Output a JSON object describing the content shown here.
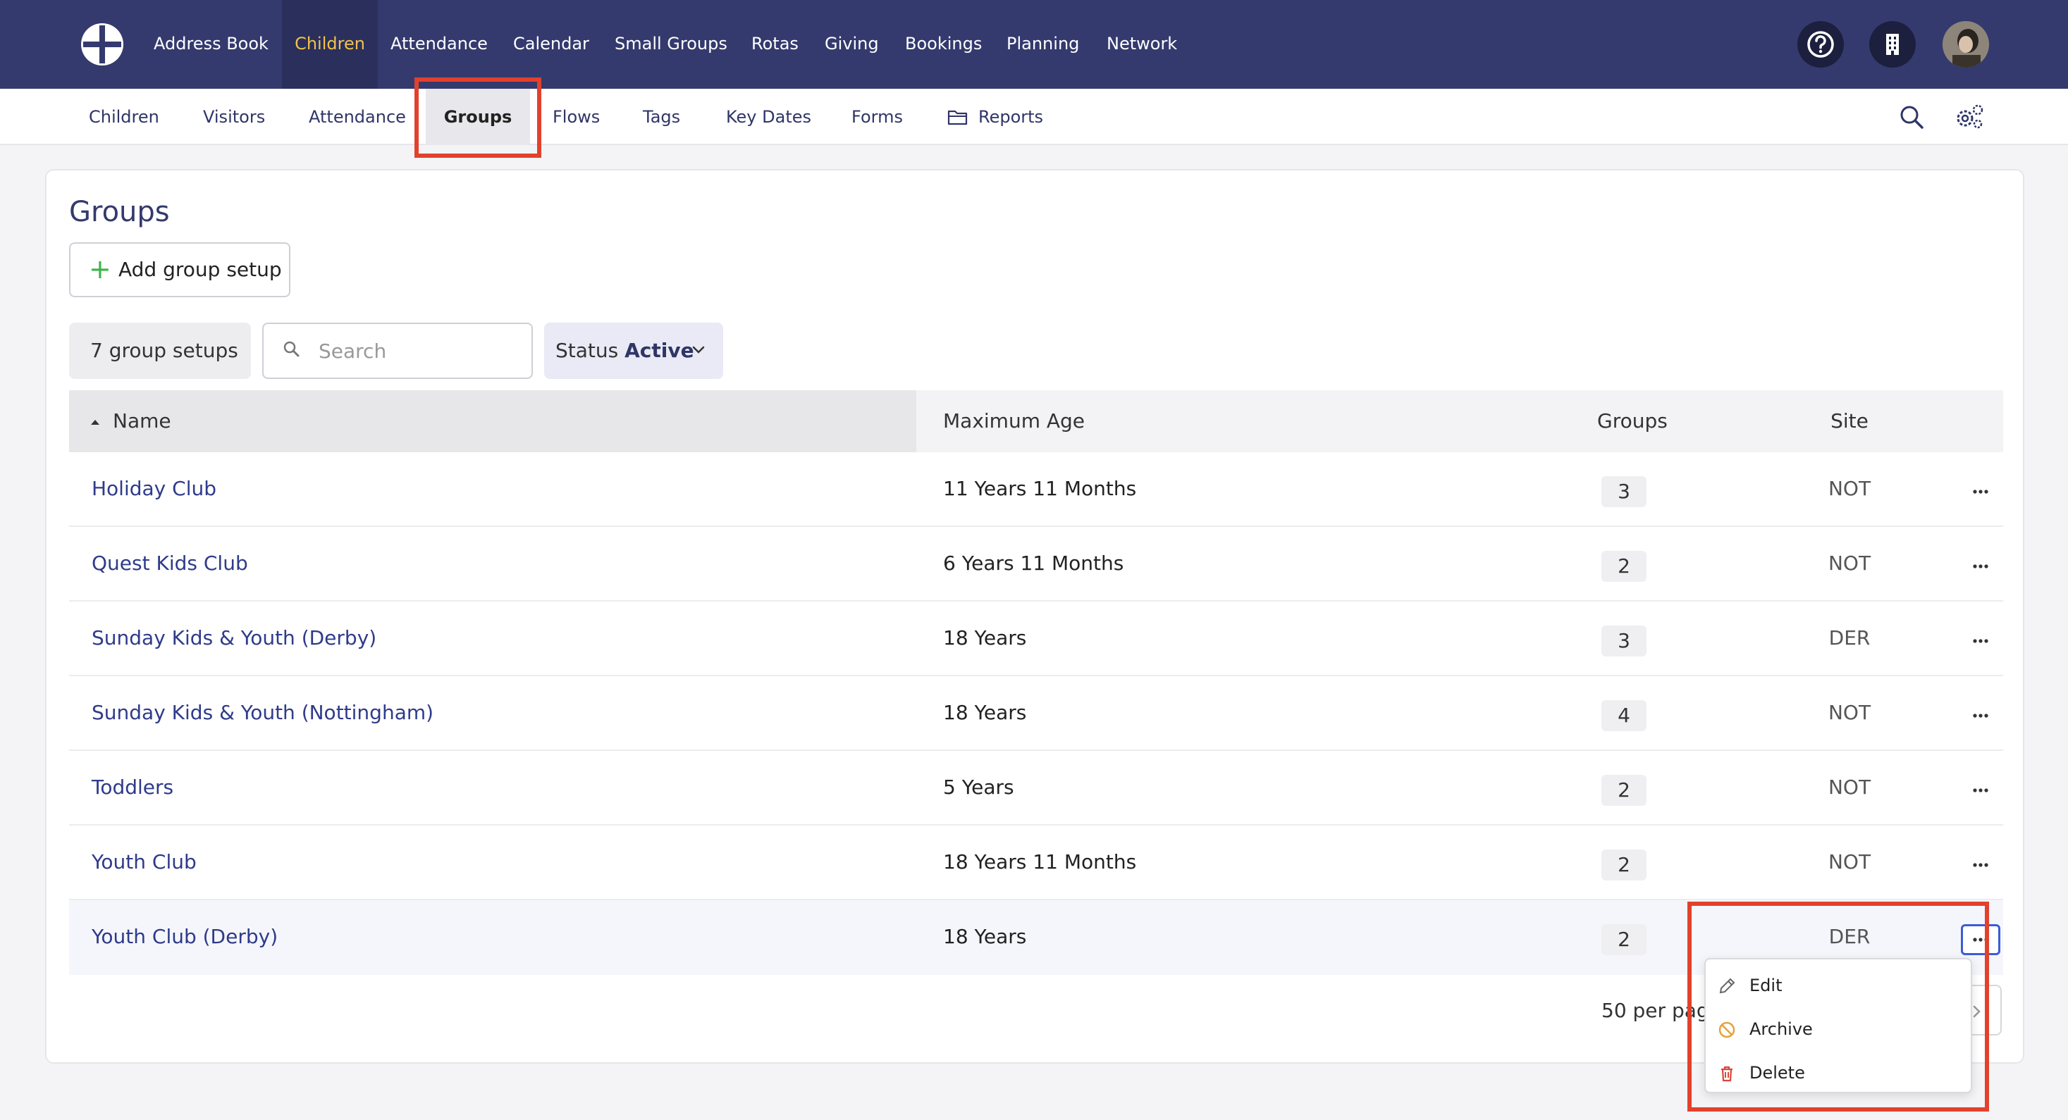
{
  "topnav": {
    "items": [
      "Address Book",
      "Children",
      "Attendance",
      "Calendar",
      "Small Groups",
      "Rotas",
      "Giving",
      "Bookings",
      "Planning",
      "Network"
    ],
    "active": "Children",
    "icons": [
      "help-icon",
      "building-icon",
      "avatar"
    ]
  },
  "subnav": {
    "items": [
      "Children",
      "Visitors",
      "Attendance",
      "Groups",
      "Flows",
      "Tags",
      "Key Dates",
      "Forms",
      "Reports"
    ],
    "active": "Groups",
    "right_icons": [
      "search-icon",
      "settings-gear-icon"
    ]
  },
  "page": {
    "title": "Groups",
    "add_button": "Add group setup",
    "count_label": "7 group setups",
    "search_placeholder": "Search",
    "status_label": "Status",
    "status_value": "Active"
  },
  "table": {
    "columns": [
      "Name",
      "Maximum Age",
      "Groups",
      "Site"
    ],
    "rows": [
      {
        "name": "Holiday Club",
        "max_age": "11 Years 11 Months",
        "groups": "3",
        "site": "NOT"
      },
      {
        "name": "Quest Kids Club",
        "max_age": "6 Years 11 Months",
        "groups": "2",
        "site": "NOT"
      },
      {
        "name": "Sunday Kids & Youth (Derby)",
        "max_age": "18 Years",
        "groups": "3",
        "site": "DER"
      },
      {
        "name": "Sunday Kids & Youth (Nottingham)",
        "max_age": "18 Years",
        "groups": "4",
        "site": "NOT"
      },
      {
        "name": "Toddlers",
        "max_age": "5 Years",
        "groups": "2",
        "site": "NOT"
      },
      {
        "name": "Youth Club",
        "max_age": "18 Years 11 Months",
        "groups": "2",
        "site": "NOT"
      },
      {
        "name": "Youth Club (Derby)",
        "max_age": "18 Years",
        "groups": "2",
        "site": "DER"
      }
    ],
    "per_page": "50 per page"
  },
  "menu": {
    "items": [
      "Edit",
      "Archive",
      "Delete"
    ]
  },
  "colors": {
    "nav_bg": "#343a6e",
    "active_nav_text": "#f2c14b",
    "link": "#2f3b8a",
    "highlight": "#e2412c"
  }
}
